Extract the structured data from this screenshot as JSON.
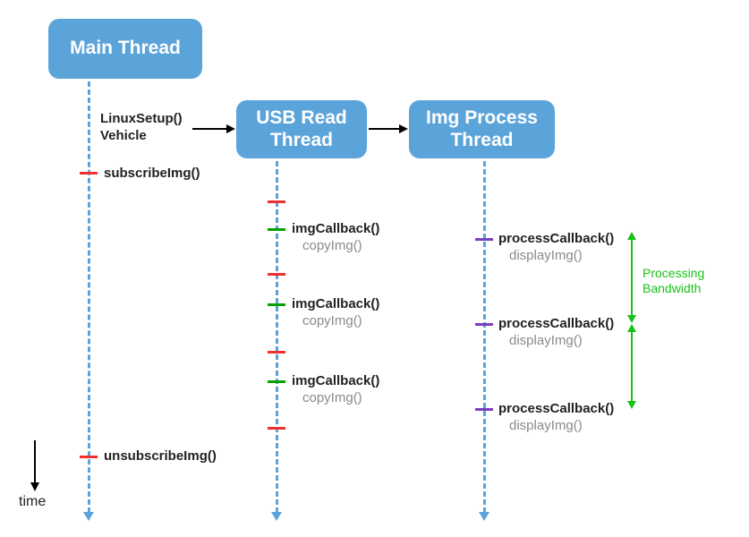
{
  "threads": {
    "main": {
      "title": "Main Thread"
    },
    "usb": {
      "title": "USB Read Thread"
    },
    "imgproc": {
      "title": "Img Process Thread"
    }
  },
  "main_events": {
    "setup_line1": "LinuxSetup()",
    "setup_line2": "Vehicle",
    "subscribe": "subscribeImg()",
    "unsubscribe": "unsubscribeImg()"
  },
  "usb_events": {
    "callback": "imgCallback()",
    "copy": "copyImg()"
  },
  "proc_events": {
    "callback": "processCallback()",
    "display": "displayImg()"
  },
  "annotations": {
    "bandwidth_line1": "Processing",
    "bandwidth_line2": "Bandwidth",
    "time_axis": "time"
  }
}
